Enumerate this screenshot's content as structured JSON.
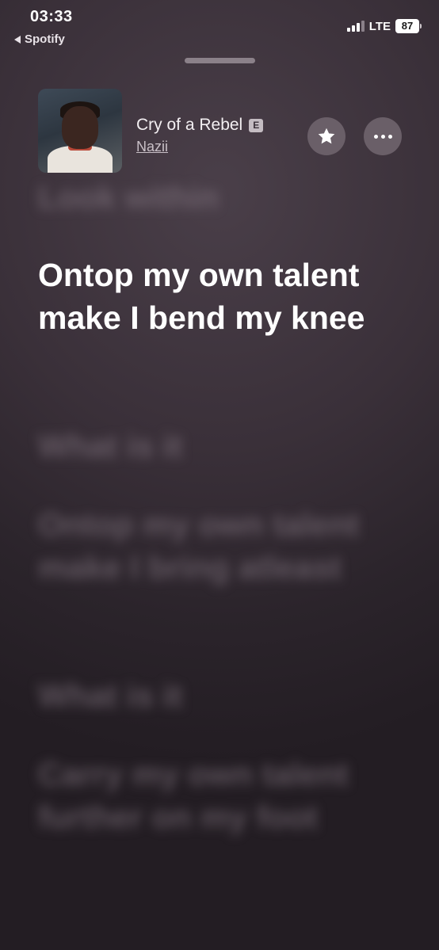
{
  "status_bar": {
    "time": "03:33",
    "back_app": "Spotify",
    "network": "LTE",
    "battery": "87"
  },
  "header": {
    "song_title": "Cry of a Rebel",
    "explicit_badge": "E",
    "artist": "Nazii",
    "icons": {
      "favorite": "star-icon",
      "more": "more-icon"
    }
  },
  "lyrics": {
    "previous_line": "Look within",
    "current_line": "Ontop my own talent make I bend my knee",
    "upcoming": [
      "What is it",
      "Ontop my own talent make I bring atleast",
      "What is it",
      "Carry my own talent further on my foot"
    ]
  },
  "colors": {
    "background": "#3a3039",
    "active_lyric": "#ffffff",
    "inactive_lyric": "#8c808a"
  }
}
